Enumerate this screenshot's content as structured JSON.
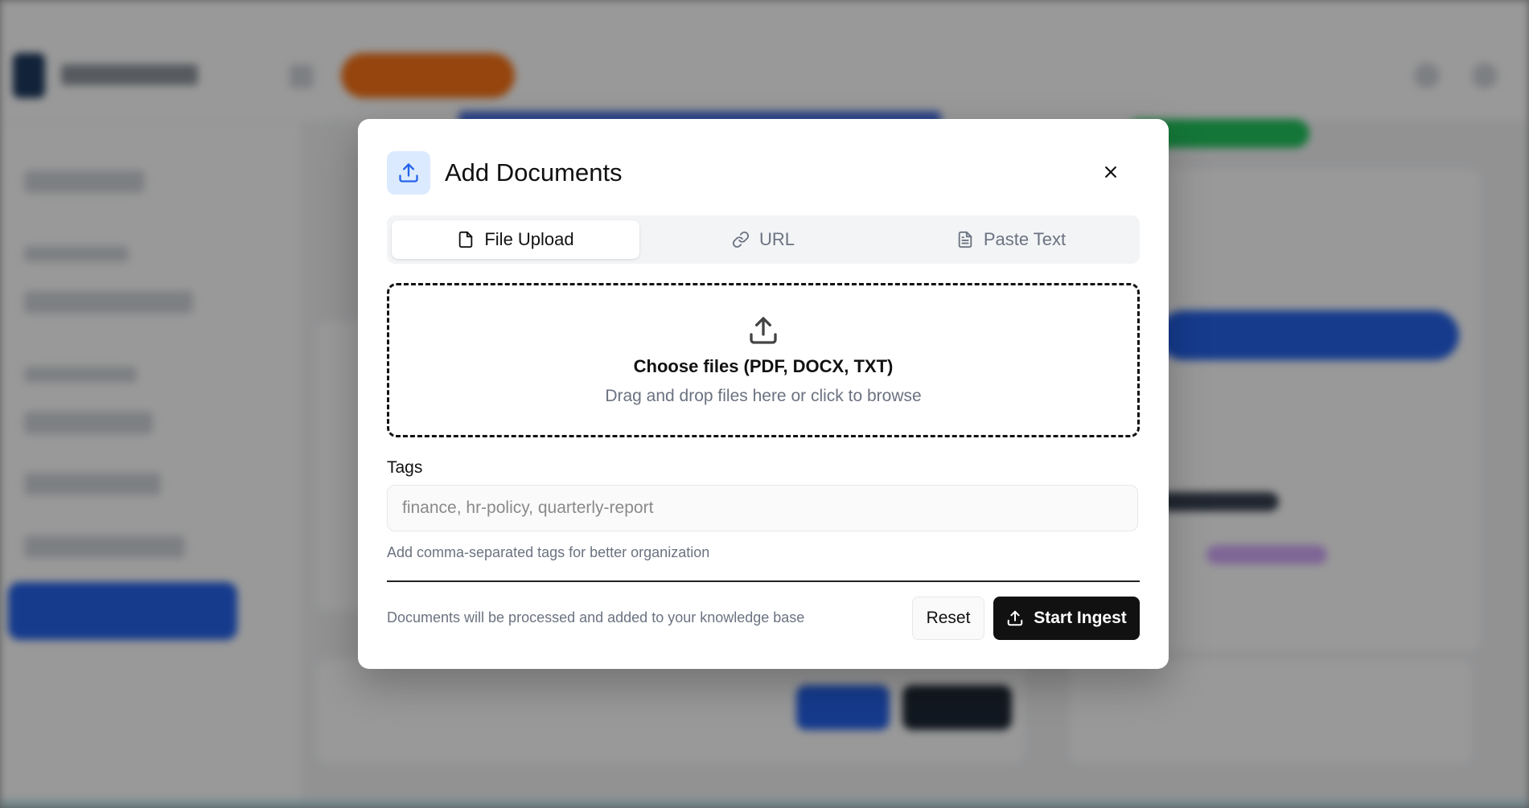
{
  "modal": {
    "title": "Add Documents",
    "header_icon": "upload-icon",
    "close_icon": "close-icon",
    "accent_color": "#2563eb"
  },
  "tabs": [
    {
      "label": "File Upload",
      "icon": "file-icon",
      "active": true
    },
    {
      "label": "URL",
      "icon": "link-icon",
      "active": false
    },
    {
      "label": "Paste Text",
      "icon": "document-text-icon",
      "active": false
    }
  ],
  "dropzone": {
    "icon": "upload-icon",
    "title": "Choose files (PDF, DOCX, TXT)",
    "subtitle": "Drag and drop files here or click to browse"
  },
  "tags": {
    "label": "Tags",
    "placeholder": "finance, hr-policy, quarterly-report",
    "value": "",
    "help": "Add comma-separated tags for better organization"
  },
  "footer": {
    "note": "Documents will be processed and added to your knowledge base",
    "reset_label": "Reset",
    "ingest_label": "Start Ingest",
    "ingest_icon": "upload-icon"
  }
}
